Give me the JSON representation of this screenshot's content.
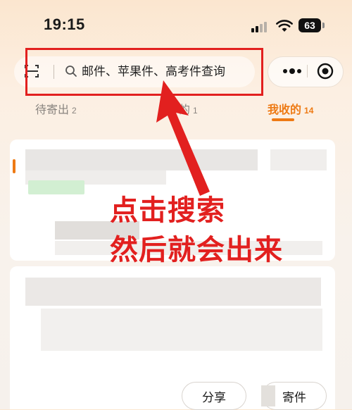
{
  "status_bar": {
    "time": "19:15",
    "battery": "63"
  },
  "header": {
    "search_placeholder": "邮件、苹果件、高考件查询",
    "icons": [
      "scan-icon",
      "search-icon",
      "more-icon",
      "close-mini-icon"
    ]
  },
  "tabs": [
    {
      "label": "待寄出",
      "count": "2",
      "active": false
    },
    {
      "label": "的",
      "count": "1",
      "active": false
    },
    {
      "label": "我收的",
      "count": "14",
      "active": true
    }
  ],
  "annotation": {
    "line1": "点击搜索",
    "line2": "然后就会出来",
    "color": "#e2201f"
  },
  "actions": {
    "share_label": "分享",
    "send_label": "寄件"
  },
  "colors": {
    "accent": "#ee7a14",
    "annotation": "#e2201f"
  }
}
